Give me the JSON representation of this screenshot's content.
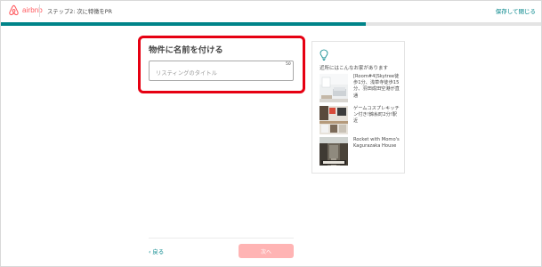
{
  "header": {
    "brand": "airbnb",
    "step_title": "ステップ2: 次に特徴をPR",
    "save_exit_label": "保存して閉じる"
  },
  "progress": {
    "fraction": 0.675
  },
  "form": {
    "title": "物件に名前を付ける",
    "input_placeholder": "リスティングのタイトル",
    "char_limit": "50"
  },
  "footer": {
    "back_label": "‹ 戻る",
    "next_label": "次へ"
  },
  "tips": {
    "icon": "lightbulb-icon",
    "heading": "近所にはこんなお家があります",
    "examples": [
      {
        "text": "[Room#4]Skytree徒歩1分、浅草寺徒歩15分、羽田成田空港が直通"
      },
      {
        "text": "ゲームコスプレキッチン付き!錦糸町2分!駅近"
      },
      {
        "text": "Rocket with Momo's Kagurazaka House"
      }
    ]
  },
  "colors": {
    "brand": "#ff5a5f",
    "accent": "#008489",
    "highlight": "#e60012",
    "next_disabled": "#ffb4b4"
  }
}
